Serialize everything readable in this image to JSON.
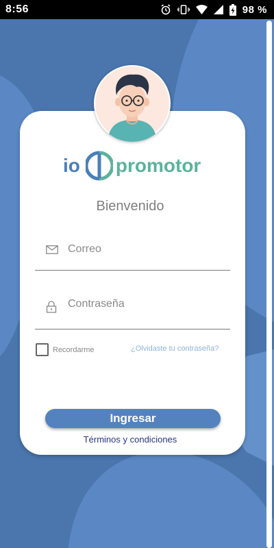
{
  "status_bar": {
    "time": "8:56",
    "battery_percent": "98 %",
    "icons": [
      "alarm-icon",
      "vibrate-icon",
      "wifi-icon",
      "signal-icon",
      "battery-charging-icon"
    ]
  },
  "brand": {
    "logo_left": "io",
    "logo_right": "promotor"
  },
  "login": {
    "welcome": "Bienvenido",
    "email_placeholder": "Correo",
    "password_placeholder": "Contraseña",
    "remember_label": "Recordarme",
    "remember_checked": false,
    "forgot_link": "¿Olvidaste tu contraseña?",
    "submit_label": "Ingresar",
    "terms_link": "Términos y condiciones"
  },
  "colors": {
    "background": "#4a76ad",
    "background_light": "#5b88c4",
    "button": "#5482bf",
    "logo_blue": "#4a7fb9",
    "logo_green": "#5bb39b",
    "terms": "#2a3380",
    "forgot": "#8fb3d8"
  }
}
